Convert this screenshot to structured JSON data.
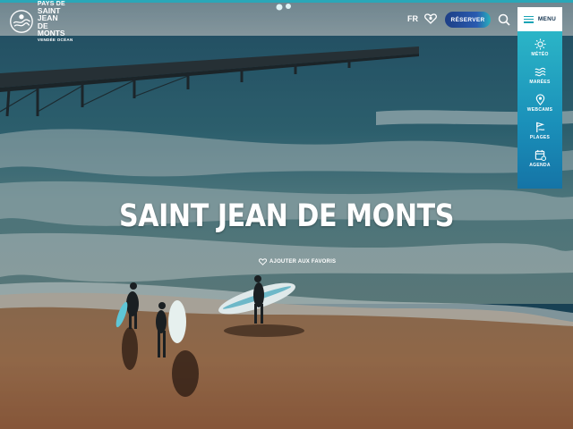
{
  "header": {
    "logo_line1": "PAYS DE",
    "logo_line2": "SAINT JEAN",
    "logo_line3": "DE MONTS",
    "logo_line4": "VENDÉE OCÉAN",
    "language": "FR",
    "favorites_icon": "heart-icon",
    "reserve_label": "RÉSERVER",
    "search_icon": "search-icon",
    "menu_label": "MENU"
  },
  "side_menu": {
    "items": [
      {
        "label": "MÉTÉO",
        "icon": "sun-icon"
      },
      {
        "label": "MARÉES",
        "icon": "waves-icon"
      },
      {
        "label": "WEBCAMS",
        "icon": "webcam-pin-icon"
      },
      {
        "label": "PLAGES",
        "icon": "beach-flag-icon"
      },
      {
        "label": "AGENDA",
        "icon": "calendar-icon"
      }
    ]
  },
  "hero": {
    "title": "SAINT JEAN DE MONTS",
    "add_favorite_label": "AJOUTER AUX FAVORIS",
    "add_favorite_icon": "heart-icon"
  },
  "colors": {
    "accent": "#2aa7b8",
    "panel_top": "#2bb5c7",
    "panel_bottom": "#1574a6",
    "reserve_start": "#1d3f86",
    "reserve_end": "#27b0bd"
  }
}
